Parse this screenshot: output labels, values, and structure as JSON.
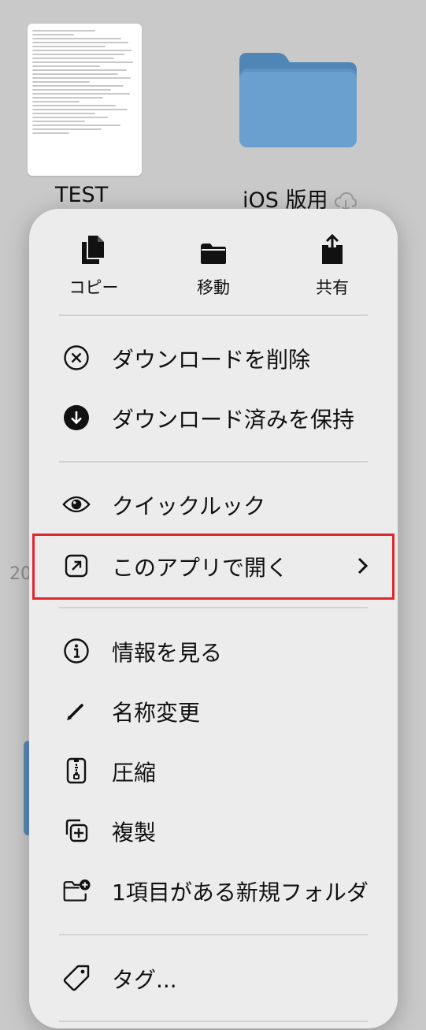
{
  "background": {
    "files": [
      {
        "name": "TEST",
        "icon": "document-thumbnail"
      },
      {
        "name": "iOS 版用",
        "icon": "folder-icon",
        "status_icon": "cloud-download-icon"
      }
    ],
    "partial_date": "20"
  },
  "menu": {
    "quick_actions": [
      {
        "label": "コピー",
        "icon": "copy-icon"
      },
      {
        "label": "移動",
        "icon": "folder-icon"
      },
      {
        "label": "共有",
        "icon": "share-icon"
      }
    ],
    "groups": [
      [
        {
          "label": "ダウンロードを削除",
          "icon": "x-circle-icon"
        },
        {
          "label": "ダウンロード済みを保持",
          "icon": "download-circle-icon"
        }
      ],
      [
        {
          "label": "クイックルック",
          "icon": "eye-icon"
        },
        {
          "label": "このアプリで開く",
          "icon": "open-external-icon",
          "has_submenu": true,
          "highlighted": true
        }
      ],
      [
        {
          "label": "情報を見る",
          "icon": "info-icon"
        },
        {
          "label": "名称変更",
          "icon": "pencil-icon"
        },
        {
          "label": "圧縮",
          "icon": "archive-icon"
        },
        {
          "label": "複製",
          "icon": "duplicate-icon"
        },
        {
          "label": "1項目がある新規フォルダ",
          "icon": "new-folder-icon"
        }
      ],
      [
        {
          "label": "タグ...",
          "icon": "tag-icon"
        }
      ]
    ]
  },
  "colors": {
    "highlight_border": "#e0262e",
    "folder_blue": "#5a8bb8",
    "menu_bg": "#ececec"
  }
}
